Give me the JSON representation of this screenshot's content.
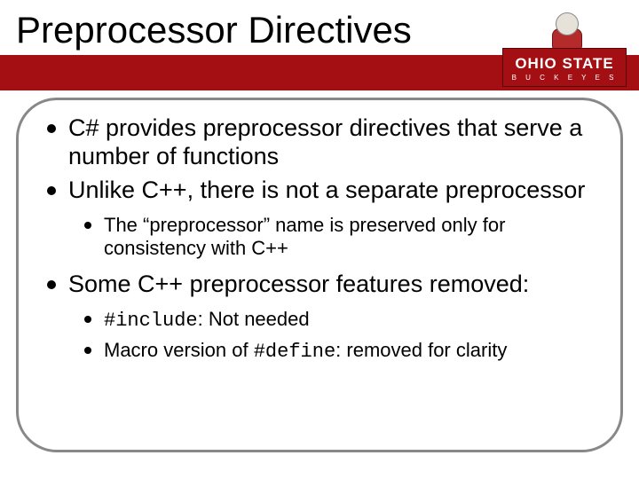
{
  "title": "Preprocessor Directives",
  "logo": {
    "line1": "OHIO STATE",
    "line2": "B U C K E Y E S"
  },
  "bullets": {
    "b1": "C# provides preprocessor directives that serve a number of functions",
    "b2": "Unlike C++, there is not a separate preprocessor",
    "b2_1": "The “preprocessor” name is preserved only for consistency with C++",
    "b3": "Some C++ preprocessor features removed:",
    "b3_1_code": "#include",
    "b3_1_rest": ": Not needed",
    "b3_2_pre": "Macro version of ",
    "b3_2_code": "#define",
    "b3_2_rest": ": removed for clarity"
  }
}
